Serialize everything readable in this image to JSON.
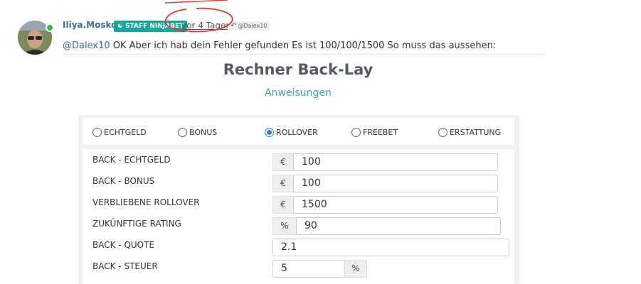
{
  "post": {
    "username": "Iliya.Moskov",
    "badge": "STAFF NINJABET",
    "timestamp": "vor 4 Tagen",
    "reply_to": "@Dalex10",
    "message_mention": "@Dalex10",
    "message_text": " OK Aber ich hab dein Fehler gefunden Es ist 100/100/1500 So muss das aussehen:"
  },
  "calculator": {
    "title": "Rechner Back-Lay",
    "instructions": "Anweisungen",
    "modes": [
      {
        "label": "ECHTGELD",
        "selected": false
      },
      {
        "label": "BONUS",
        "selected": false
      },
      {
        "label": "ROLLOVER",
        "selected": true
      },
      {
        "label": "FREEBET",
        "selected": false
      },
      {
        "label": "ERSTATTUNG",
        "selected": false
      }
    ],
    "fields": [
      {
        "label": "BACK - ECHTGELD",
        "prefix": "€",
        "value": "100"
      },
      {
        "label": "BACK - BONUS",
        "prefix": "€",
        "value": "100"
      },
      {
        "label": "VERBLIEBENE ROLLOVER",
        "prefix": "€",
        "value": "1500"
      },
      {
        "label": "ZUKÜNFTIGE RATING",
        "prefix": "%",
        "value": "90"
      },
      {
        "label": "BACK - QUOTE",
        "value": "2.1"
      },
      {
        "label": "BACK - STEUER",
        "value": "5",
        "suffix": "%"
      }
    ]
  },
  "colors": {
    "username": "#3c6c9a",
    "badge": "#1aa59a",
    "online": "#4caf50",
    "annotation": "#e53935",
    "instructions": "#4aa3a0",
    "radio_selected": "#3b78d8"
  }
}
